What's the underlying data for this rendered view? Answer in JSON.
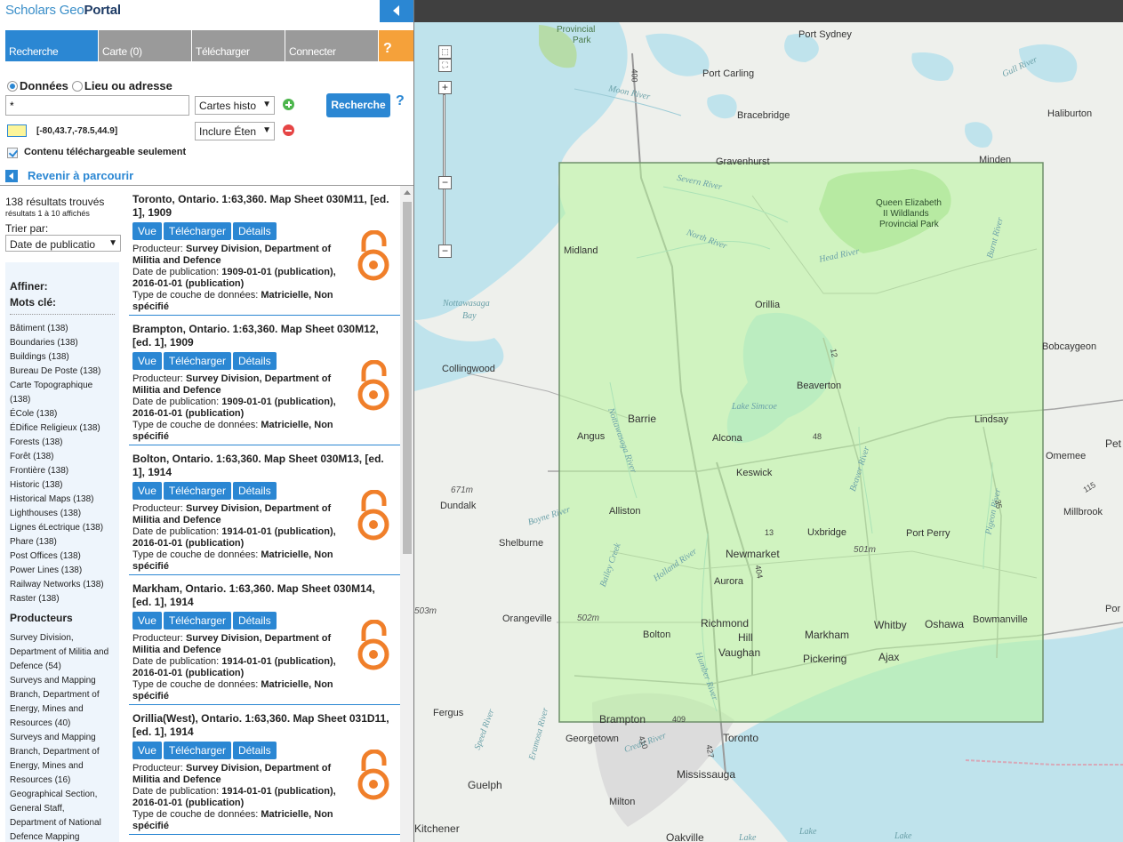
{
  "brand": {
    "part1": "Scholars",
    "part2": "Geo",
    "part3": "Portal"
  },
  "nav": {
    "tabs": [
      "Recherche",
      "Carte (0)",
      "Télécharger",
      "Connecter"
    ],
    "help": "?"
  },
  "search": {
    "radio_data": "Données",
    "radio_place": "Lieu ou adresse",
    "query": "*",
    "type_select": "Cartes histo",
    "extent_select": "Inclure Éten",
    "button": "Recherche",
    "help": "?",
    "bbox": "[-80,43.7,-78.5,44.9]",
    "downloadable_only": "Contenu téléchargeable seulement",
    "back": "Revenir à parcourir"
  },
  "facets": {
    "count": "138 résultats trouvés",
    "range": "résultats 1 à 10 affichés",
    "sort_label": "Trier par:",
    "sort_value": "Date de publicatio",
    "refine": "Affiner:",
    "keywords_title": "Mots clé:",
    "keywords": [
      "Bâtiment (138)",
      "Boundaries (138)",
      "Buildings (138)",
      "Bureau De Poste (138)",
      "Carte Topographique",
      "(138)",
      "ÉCole (138)",
      "ÉDifice Religieux (138)",
      "Forests (138)",
      "Forêt (138)",
      "Frontière (138)",
      "Historic (138)",
      "Historical Maps (138)",
      "Lighthouses (138)",
      "Lignes éLectrique (138)",
      "Phare (138)",
      "Post Offices (138)",
      "Power Lines (138)",
      "Railway Networks (138)",
      "Raster (138)"
    ],
    "producers_title": "Producteurs",
    "producers": [
      "Survey Division,",
      "Department of Militia and",
      "Defence (54)",
      "Surveys and Mapping",
      "Branch, Department of",
      "Energy, Mines and",
      "Resources (40)",
      "Surveys and Mapping",
      "Branch, Department of",
      "Energy, Mines and",
      "Resources (16)",
      "Geographical Section,",
      "General Staff,",
      "Department of National",
      "Defence Mapping"
    ]
  },
  "results": {
    "btn_view": "Vue",
    "btn_download": "Télécharger",
    "btn_details": "Détails",
    "lbl_producer": "Producteur:",
    "lbl_date": "Date de publication:",
    "lbl_type": "Type de couche de données:",
    "items": [
      {
        "title": "Toronto, Ontario. 1:63,360. Map Sheet 030M11, [ed. 1], 1909",
        "producer": "Survey Division, Department of Militia and Defence",
        "date": "1909-01-01 (publication), 2016-01-01 (publication)",
        "type": "Matricielle, Non spécifié"
      },
      {
        "title": "Brampton, Ontario. 1:63,360. Map Sheet 030M12, [ed. 1], 1909",
        "producer": "Survey Division, Department of Militia and Defence",
        "date": "1909-01-01 (publication), 2016-01-01 (publication)",
        "type": "Matricielle, Non spécifié"
      },
      {
        "title": "Bolton, Ontario. 1:63,360. Map Sheet 030M13, [ed. 1], 1914",
        "producer": "Survey Division, Department of Militia and Defence",
        "date": "1914-01-01 (publication), 2016-01-01 (publication)",
        "type": "Matricielle, Non spécifié"
      },
      {
        "title": "Markham, Ontario. 1:63,360. Map Sheet 030M14, [ed. 1], 1914",
        "producer": "Survey Division, Department of Militia and Defence",
        "date": "1914-01-01 (publication), 2016-01-01 (publication)",
        "type": "Matricielle, Non spécifié"
      },
      {
        "title": "Orillia(West), Ontario. 1:63,360. Map Sheet 031D11, [ed. 1], 1914",
        "producer": "Survey Division, Department of Militia and Defence",
        "date": "1914-01-01 (publication), 2016-01-01 (publication)",
        "type": "Matricielle, Non spécifié"
      }
    ]
  },
  "map": {
    "towns": [
      "Port Sydney",
      "Port Carling",
      "Bracebridge",
      "Gravenhurst",
      "Haliburton",
      "Minden",
      "Midland",
      "Orillia",
      "Collingwood",
      "Beaverton",
      "Barrie",
      "Angus",
      "Alcona",
      "Keswick",
      "Lindsay",
      "Omemee",
      "Dundalk",
      "Alliston",
      "Shelburne",
      "Uxbridge",
      "Port Perry",
      "Newmarket",
      "Aurora",
      "Orangeville",
      "Bolton",
      "Richmond",
      "Hill",
      "Vaughan",
      "Markham",
      "Pickering",
      "Whitby",
      "Oshawa",
      "Bowmanville",
      "Ajax",
      "Brampton",
      "Georgetown",
      "Toronto",
      "Mississauga",
      "Fergus",
      "Guelph",
      "Milton",
      "Oakville",
      "Kitchener",
      "Bobcaygeon",
      "Millbrook",
      "Pet",
      "Por"
    ],
    "water": [
      "Moon River",
      "Severn River",
      "North River",
      "Head River",
      "Burnt River",
      "Nottawasaga",
      "Bay",
      "Lake Simcoe",
      "Nottawasaga River",
      "Beaver River",
      "Pigeon River",
      "Boyne River",
      "Bailey Creek",
      "Holland River",
      "Humber River",
      "Credit River",
      "Eramosa River",
      "Speed River",
      "Gull River",
      "Lake",
      "Lake",
      "Lake"
    ],
    "parks": [
      "Provincial",
      "Park",
      "Queen Elizabeth",
      "II Wildlands",
      "Provincial Park"
    ],
    "roads": [
      "400",
      "12",
      "48",
      "13",
      "404",
      "410",
      "427",
      "409",
      "115",
      "35"
    ],
    "elevations": [
      "671m",
      "501m",
      "502m",
      "503m"
    ],
    "zoom": {
      "in": "+",
      "out": "−",
      "extra": "−"
    }
  },
  "colors": {
    "accent": "#2b87d3",
    "help": "#f5a13a",
    "oa": "#f07f2a",
    "bbox": "#b8f59d"
  }
}
